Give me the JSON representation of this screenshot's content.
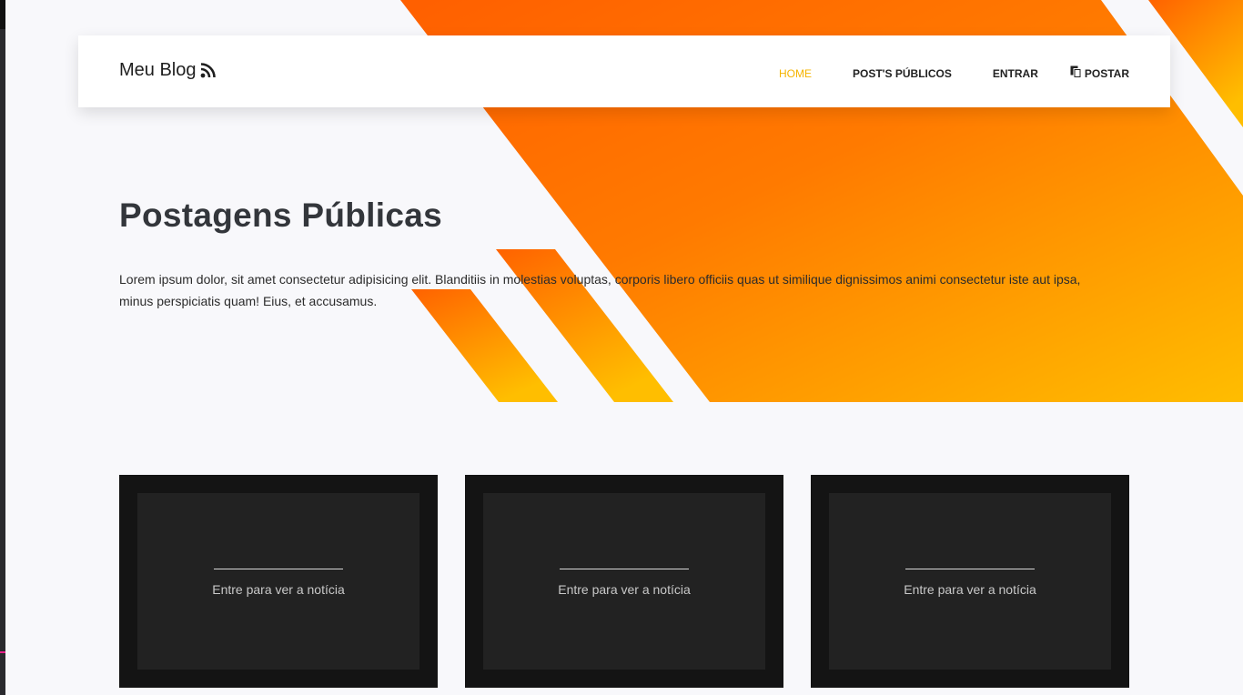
{
  "navbar": {
    "brand": "Meu Blog",
    "brand_icon": "rss-icon",
    "links": [
      {
        "label": "HOME",
        "active": true
      },
      {
        "label": "POST'S PÚBLICOS",
        "active": false
      },
      {
        "label": "ENTRAR",
        "active": false
      },
      {
        "label": "POSTAR",
        "active": false,
        "icon": "copy-icon"
      }
    ]
  },
  "hero": {
    "title": "Postagens Públicas",
    "text": "Lorem ipsum dolor, sit amet consectetur adipisicing elit. Blanditiis in molestias voluptas, corporis libero officiis quas ut similique dignissimos animi consectetur iste aut ipsa, minus perspiciatis quam! Eius, et accusamus."
  },
  "cards": [
    {
      "label": "Entre para ver a notícia"
    },
    {
      "label": "Entre para ver a notícia"
    },
    {
      "label": "Entre para ver a notícia"
    }
  ],
  "colors": {
    "accent": "#f5b400",
    "gradient_start": "#ff6a00",
    "gradient_end": "#ffb800",
    "card_bg": "#141414"
  }
}
